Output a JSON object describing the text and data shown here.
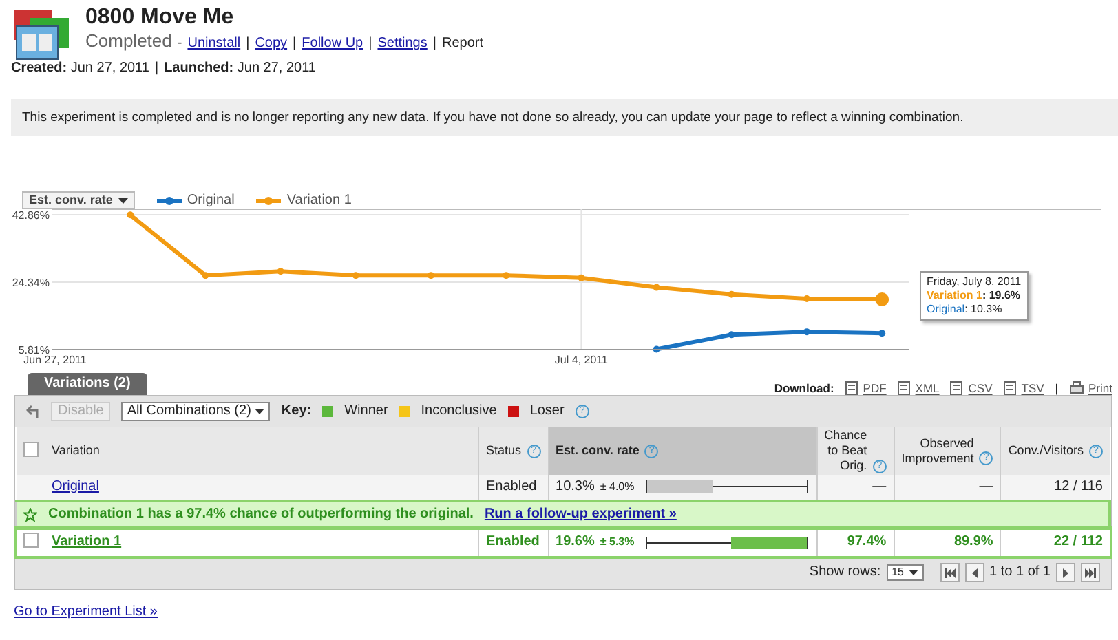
{
  "header": {
    "title": "0800 Move Me",
    "status": "Completed",
    "dash": "-",
    "links": [
      {
        "label": "Uninstall",
        "kind": "link"
      },
      {
        "separator": "|",
        "kind": "separator"
      },
      {
        "label": "Copy",
        "kind": "link"
      },
      {
        "separator": "|",
        "kind": "separator"
      },
      {
        "label": "Follow Up",
        "kind": "link"
      },
      {
        "separator": "|",
        "kind": "separator"
      },
      {
        "label": "Settings",
        "kind": "link"
      },
      {
        "separator": "|",
        "kind": "separator"
      },
      {
        "label": "Report",
        "kind": "current"
      }
    ],
    "dates": [
      {
        "label": "Created:",
        "value": "Jun 27, 2011"
      },
      {
        "separator": "|"
      },
      {
        "label": "Launched:",
        "value": "Jun 27, 2011"
      }
    ]
  },
  "notice": "This experiment is completed and is no longer reporting any new data. If you have not done so already, you can update your page to reflect a winning combination.",
  "chart": {
    "metric": "Est. conv. rate",
    "chart_data": {
      "type": "line",
      "legend": true,
      "categories": [
        "Jun 27, 2011",
        null,
        null,
        null,
        null,
        null,
        null,
        "Jul 4, 2011",
        null,
        null,
        null,
        null
      ],
      "series": [
        {
          "name": "Original",
          "color": "#1a73c2",
          "marker": "circle",
          "values": [
            null,
            null,
            null,
            null,
            null,
            null,
            null,
            null,
            5.9,
            9.9,
            10.7,
            10.3
          ]
        },
        {
          "name": "Variation 1",
          "color": "#f29b12",
          "marker": "circle",
          "values": [
            null,
            42.8,
            26.2,
            27.3,
            26.2,
            26.2,
            26.2,
            25.5,
            22.9,
            21.0,
            19.8,
            19.6
          ]
        }
      ],
      "ylim": [
        5.81,
        42.86
      ],
      "yticks": [
        {
          "value": 5.81,
          "label": "5.81%"
        },
        {
          "value": 24.34,
          "label": "24.34%"
        },
        {
          "value": 42.86,
          "label": "42.86%"
        }
      ]
    },
    "tooltip": {
      "date": "Friday, July 8, 2011",
      "lines": [
        {
          "label": "Variation 1",
          "value": ": 19.6%",
          "color": "#f29b12"
        },
        {
          "label": "Original",
          "value": ": 10.3%",
          "color": "#1a73c2"
        }
      ]
    }
  },
  "tab": {
    "label": "Variations (2)"
  },
  "download": {
    "label": "Download:",
    "formats": [
      "PDF",
      "XML",
      "CSV",
      "TSV"
    ],
    "separator": "|",
    "print": "Print"
  },
  "toolbar": {
    "disable": "Disable",
    "filter": "All Combinations (2)",
    "key_label": "Key:",
    "key": [
      {
        "label": "Winner",
        "color": "#5cb83c"
      },
      {
        "label": "Inconclusive",
        "color": "#f5c518"
      },
      {
        "label": "Loser",
        "color": "#cc1111"
      }
    ],
    "help": "?"
  },
  "table": {
    "select_all_checked": false,
    "columns": [
      {
        "label": "Variation"
      },
      {
        "label": "Status",
        "help": "?"
      },
      {
        "label": "Est. conv. rate",
        "help": "?"
      },
      {
        "label": "Chance to Beat Orig.",
        "help": "?"
      },
      {
        "label": "Observed Improvement",
        "help": "?"
      },
      {
        "label": "Conv./Visitors",
        "help": "?"
      }
    ],
    "rows": [
      {
        "name": "Original",
        "status": "Enabled",
        "rate": "10.3%",
        "margin": "± 4.0%",
        "level": 0.42,
        "chance": "—",
        "improvement": "—",
        "conv": "12 / 116",
        "winner": false
      },
      {
        "banner": "Combination 1 has a 97.4% chance of outperforming the original.",
        "banner_link": "Run a follow-up experiment »",
        "name": "Variation 1",
        "status": "Enabled",
        "rate": "19.6%",
        "margin": "± 5.3%",
        "level": 0.47,
        "chance": "97.4%",
        "improvement": "89.9%",
        "conv": "22 / 112",
        "winner": true,
        "checked": false
      }
    ]
  },
  "pager": {
    "label": "Show rows:",
    "rows": "15",
    "range": "1 to 1 of 1"
  },
  "footer_link": "Go to Experiment List »"
}
